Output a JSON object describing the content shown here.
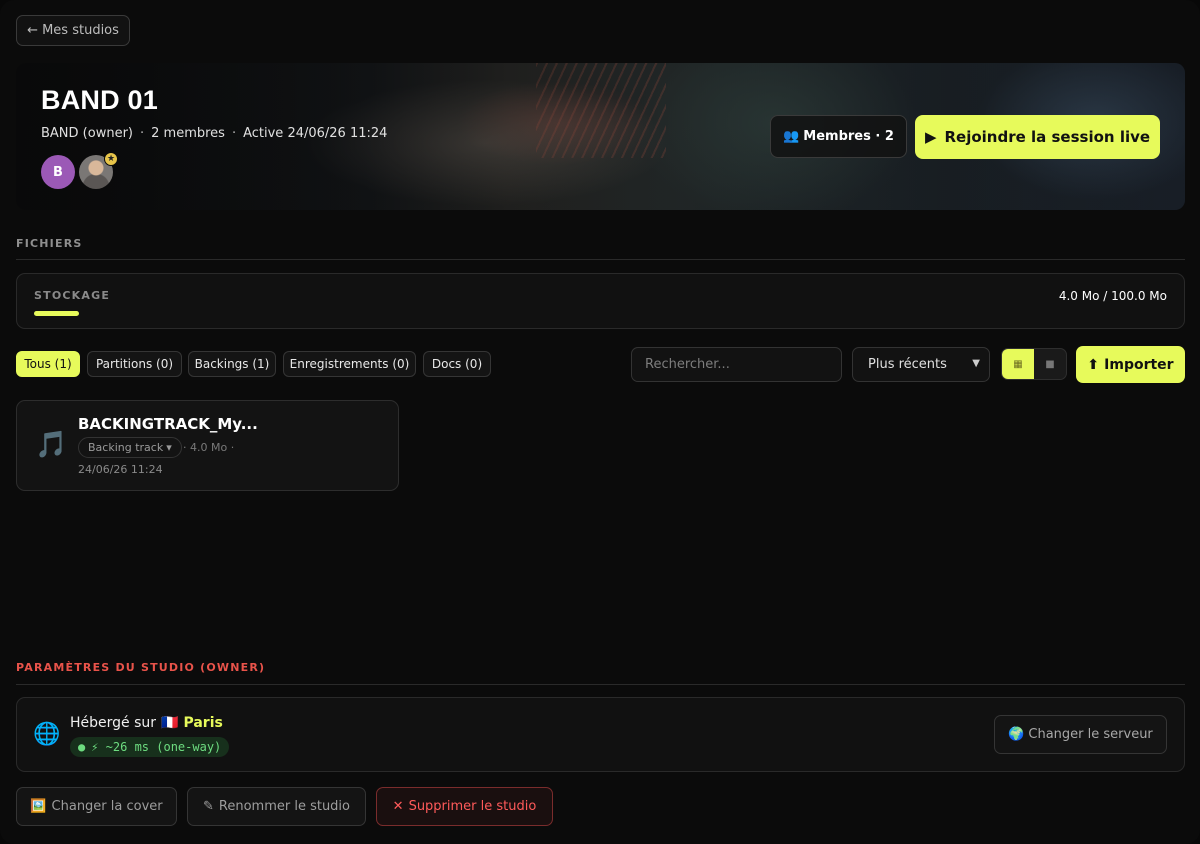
{
  "nav": {
    "back_label": "← Mes studios"
  },
  "hero": {
    "title": "BAND 01",
    "owner": "BAND (owner)",
    "members": "2 membres",
    "active": "Active 24/06/26 11:24",
    "separator": "·",
    "avatar_initial": "B",
    "members_icon": "👥",
    "members_label": "Membres · 2",
    "live_icon": "▶",
    "live_label": "Rejoindre la session live"
  },
  "files": {
    "section_label": "FICHIERS",
    "storage": {
      "label": "STOCKAGE",
      "value": "4.0 Mo / 100.0 Mo",
      "used_fraction": 0.04
    },
    "tabs": [
      {
        "label": "Tous (1)",
        "active": true
      },
      {
        "label": "Partitions (0)",
        "active": false
      },
      {
        "label": "Backings (1)",
        "active": false
      },
      {
        "label": "Enregistrements (0)",
        "active": false
      },
      {
        "label": "Docs (0)",
        "active": false
      }
    ],
    "search_placeholder": "Rechercher...",
    "sort_value": "Plus récents",
    "view_grid_icon": "▦",
    "view_list_icon": "■",
    "import_icon": "⬆",
    "import_label": "Importer",
    "items": [
      {
        "icon": "🎵",
        "name": "BACKINGTRACK_My...",
        "type": "Backing track",
        "type_caret": "▾",
        "size": "· 4.0 Mo ·",
        "date": "24/06/26 11:24"
      }
    ]
  },
  "settings": {
    "section_label": "PARAMÈTRES DU STUDIO (OWNER)",
    "hosted_prefix": "Hébergé sur",
    "flag": "🇫🇷",
    "city": "Paris",
    "latency_dot": "●",
    "latency": "⚡ ~26 ms (one-way)",
    "server_icon": "🌍",
    "server_label": "Changer le serveur",
    "actions": [
      {
        "icon": "🖼️",
        "label": "Changer la cover",
        "danger": false
      },
      {
        "icon": "✎",
        "label": "Renommer le studio",
        "danger": false
      },
      {
        "icon": "✕",
        "label": "Supprimer le studio",
        "danger": true
      }
    ]
  },
  "colors": {
    "accent": "#e7fa5b",
    "danger": "#ff5a5a",
    "section_danger": "#e8534a",
    "latency": "#6ddc80",
    "avatar": "#9b59b6"
  }
}
